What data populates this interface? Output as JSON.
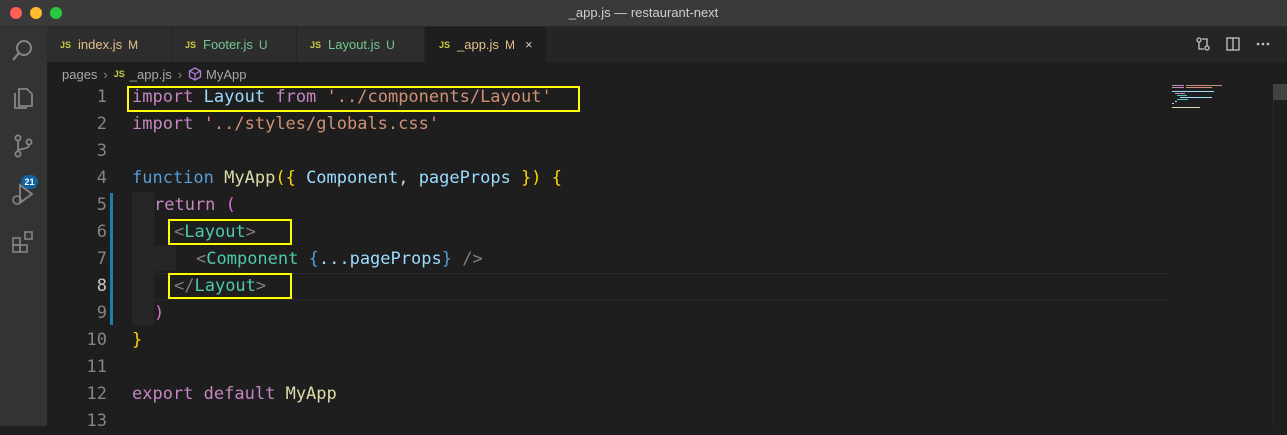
{
  "window": {
    "title": "_app.js — restaurant-next"
  },
  "activity_bar": {
    "items": [
      {
        "name": "search-icon"
      },
      {
        "name": "explorer-icon"
      },
      {
        "name": "source-control-icon"
      },
      {
        "name": "run-debug-icon"
      },
      {
        "name": "extensions-icon"
      }
    ],
    "scm_badge": "21"
  },
  "tabs": [
    {
      "icon": "JS",
      "label": "index.js",
      "status": "M",
      "active": false
    },
    {
      "icon": "JS",
      "label": "Footer.js",
      "status": "U",
      "active": false
    },
    {
      "icon": "JS",
      "label": "Layout.js",
      "status": "U",
      "active": false
    },
    {
      "icon": "JS",
      "label": "_app.js",
      "status": "M",
      "active": true,
      "close": "×"
    }
  ],
  "breadcrumb": {
    "folder": "pages",
    "file_icon": "JS",
    "file": "_app.js",
    "symbol": "MyApp"
  },
  "editor": {
    "line_numbers": [
      "1",
      "2",
      "3",
      "4",
      "5",
      "6",
      "7",
      "8",
      "9",
      "10",
      "11",
      "12",
      "13"
    ],
    "current_line": "8",
    "lines": [
      {
        "t1": "import",
        "t2": "Layout",
        "t3": "from",
        "t4": "'../components/Layout'"
      },
      {
        "t1": "import",
        "t2": "'../styles/globals.css'"
      },
      {},
      {
        "t1": "function",
        "t2": "MyApp",
        "t3": "({",
        "t4": "Component",
        "t5": ",",
        "t6": "pageProps",
        "t7": "})",
        "t8": "{"
      },
      {
        "t1": "return",
        "t2": "("
      },
      {
        "t1": "<",
        "t2": "Layout",
        "t3": ">"
      },
      {
        "t1": "<",
        "t2": "Component",
        "t3": "{",
        "t4": "...pageProps",
        "t5": "}",
        "t6": "/>"
      },
      {
        "t1": "</",
        "t2": "Layout",
        "t3": ">"
      },
      {
        "t1": ")"
      },
      {
        "t1": "}"
      },
      {},
      {
        "t1": "export",
        "t2": "default",
        "t3": "MyApp"
      },
      {}
    ]
  },
  "colors": {
    "highlight_box": "#ffff00",
    "keyword": "#c586c0",
    "variable": "#9cdcfe",
    "string": "#ce9178",
    "function": "#dcdcaa",
    "jsx_tag": "#4ec9b0",
    "modified": "#e2c08d",
    "untracked": "#73c991"
  }
}
